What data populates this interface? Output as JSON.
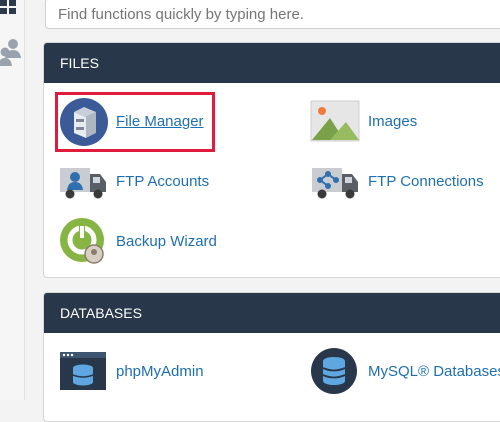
{
  "search": {
    "placeholder": "Find functions quickly by typing here."
  },
  "sidebar": {
    "icons": [
      "grid-icon",
      "users-icon"
    ]
  },
  "files": {
    "title": "FILES",
    "items": [
      {
        "label": "File Manager",
        "icon": "file-manager-icon",
        "highlighted": true
      },
      {
        "label": "Images",
        "icon": "images-icon"
      },
      {
        "label": "FTP Accounts",
        "icon": "ftp-accounts-icon"
      },
      {
        "label": "FTP Connections",
        "icon": "ftp-connections-icon"
      },
      {
        "label": "Backup Wizard",
        "icon": "backup-wizard-icon"
      }
    ]
  },
  "databases": {
    "title": "DATABASES",
    "items": [
      {
        "label": "phpMyAdmin",
        "icon": "phpmyadmin-icon"
      },
      {
        "label": "MySQL® Databases",
        "icon": "mysql-databases-icon"
      }
    ]
  },
  "colors": {
    "header_bg": "#28384a",
    "link": "#1f6fb0",
    "highlight": "#e01b3c"
  }
}
